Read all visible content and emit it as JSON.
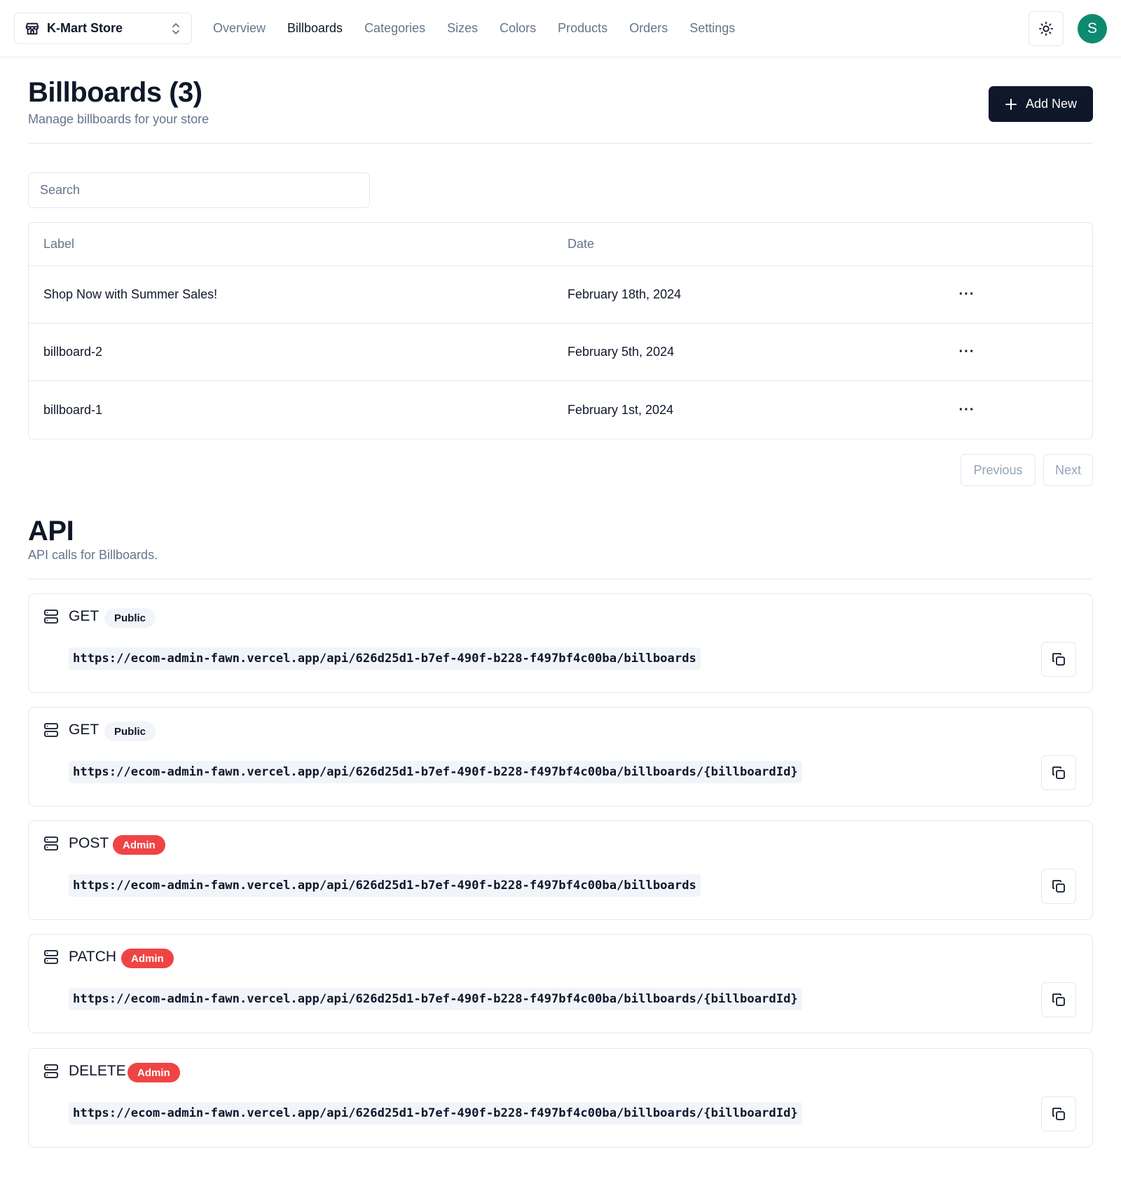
{
  "header": {
    "store_name": "K-Mart Store",
    "nav": [
      "Overview",
      "Billboards",
      "Categories",
      "Sizes",
      "Colors",
      "Products",
      "Orders",
      "Settings"
    ],
    "active_nav": "Billboards",
    "avatar_initial": "S",
    "avatar_color": "#0d8a6f",
    "icons": {
      "store": "store-icon",
      "switcher": "chevrons-up-down-icon",
      "theme": "sun-icon"
    }
  },
  "billboards": {
    "title": "Billboards (3)",
    "description": "Manage billboards for your store",
    "add_new_label": "Add New",
    "search_placeholder": "Search",
    "columns": {
      "label": "Label",
      "date": "Date"
    },
    "rows": [
      {
        "label": "Shop Now with Summer Sales!",
        "date": "February 18th, 2024",
        "action": "···"
      },
      {
        "label": "billboard-2",
        "date": "February 5th, 2024",
        "action": "···"
      },
      {
        "label": "billboard-1",
        "date": "February 1st, 2024",
        "action": "···"
      }
    ],
    "previous_label": "Previous",
    "next_label": "Next"
  },
  "api": {
    "title": "API",
    "description": "API calls for Billboards.",
    "routes": [
      {
        "method": "GET",
        "access": "Public",
        "url": "https://ecom-admin-fawn.vercel.app/api/626d25d1-b7ef-490f-b228-f497bf4c00ba/billboards"
      },
      {
        "method": "GET",
        "access": "Public",
        "url": "https://ecom-admin-fawn.vercel.app/api/626d25d1-b7ef-490f-b228-f497bf4c00ba/billboards/{billboardId}"
      },
      {
        "method": "POST",
        "access": "Admin",
        "url": "https://ecom-admin-fawn.vercel.app/api/626d25d1-b7ef-490f-b228-f497bf4c00ba/billboards"
      },
      {
        "method": "PATCH",
        "access": "Admin",
        "url": "https://ecom-admin-fawn.vercel.app/api/626d25d1-b7ef-490f-b228-f497bf4c00ba/billboards/{billboardId}"
      },
      {
        "method": "DELETE",
        "access": "Admin",
        "url": "https://ecom-admin-fawn.vercel.app/api/626d25d1-b7ef-490f-b228-f497bf4c00ba/billboards/{billboardId}"
      }
    ]
  },
  "colors": {
    "primary": "#0f172a",
    "admin_badge": "#ef4444",
    "public_badge": "#f1f5f9",
    "muted": "#64748b"
  }
}
